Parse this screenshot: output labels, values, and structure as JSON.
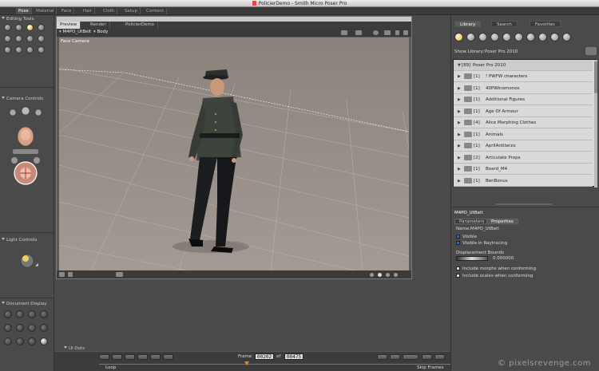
{
  "window": {
    "title": "PolicierDemo - Smith Micro Poser Pro"
  },
  "rooms": [
    "Pose",
    "Material",
    "Face",
    "Hair",
    "Cloth",
    "Setup",
    "Content"
  ],
  "left_panel": {
    "editing_tools_label": "Editing Tools",
    "camera_controls_label": "Camera Controls",
    "light_controls_label": "Light Controls",
    "document_display_label": "Document Display",
    "ui_dots_label": "UI Dots"
  },
  "document": {
    "tabs": [
      "Preview",
      "Render",
      "PolicierDemo"
    ],
    "active_tab": "Preview",
    "actor_dropdown": "M4PO_UtBelt",
    "body_dropdown": "Body",
    "camera_label": "Face Camera"
  },
  "timeline": {
    "frame_label": "Frame",
    "current_frame": "00202",
    "of_label": "of",
    "total_frames": "00475",
    "loop_label": "Loop",
    "skip_frames_label": "Skip Frames"
  },
  "library": {
    "tabs": [
      "Library",
      "Search",
      "Favorites"
    ],
    "show_library_label": "Show Library:",
    "selected_library": "Poser Pro 2010",
    "header_count": "[89]",
    "header_name": "Poser Pro 2010",
    "items": [
      {
        "count": "[1]",
        "name": "! PWFW characters"
      },
      {
        "count": "[1]",
        "name": "40PWinomonos"
      },
      {
        "count": "[1]",
        "name": "Additional Figures"
      },
      {
        "count": "[1]",
        "name": "Age Of Armour"
      },
      {
        "count": "[4]",
        "name": "Alice Morphing Clothes"
      },
      {
        "count": "[1]",
        "name": "Animals"
      },
      {
        "count": "[1]",
        "name": "AprilAntiterzo"
      },
      {
        "count": "[2]",
        "name": "Articulate Props"
      },
      {
        "count": "[1]",
        "name": "Board_M4"
      },
      {
        "count": "[1]",
        "name": "BenBonus"
      }
    ]
  },
  "properties": {
    "object_title": "M4PO_UtBelt",
    "tabs": [
      "Parameters",
      "Properties"
    ],
    "name_label": "Name:",
    "name_value": "M4PO_UtBelt",
    "visible_label": "Visible",
    "visible_raytracing_label": "Visible in Raytracing",
    "displacement_label": "Displacement Bounds",
    "displacement_value": "0.000000",
    "include_morphs_label": "Include morphs when conforming",
    "include_scales_label": "Include scales when conforming"
  },
  "watermark": "© pixelsrevenge.com",
  "colors": {
    "accent": "#d5a020",
    "library_bg": "#d9d9d9",
    "viewport": "#9a918b"
  }
}
